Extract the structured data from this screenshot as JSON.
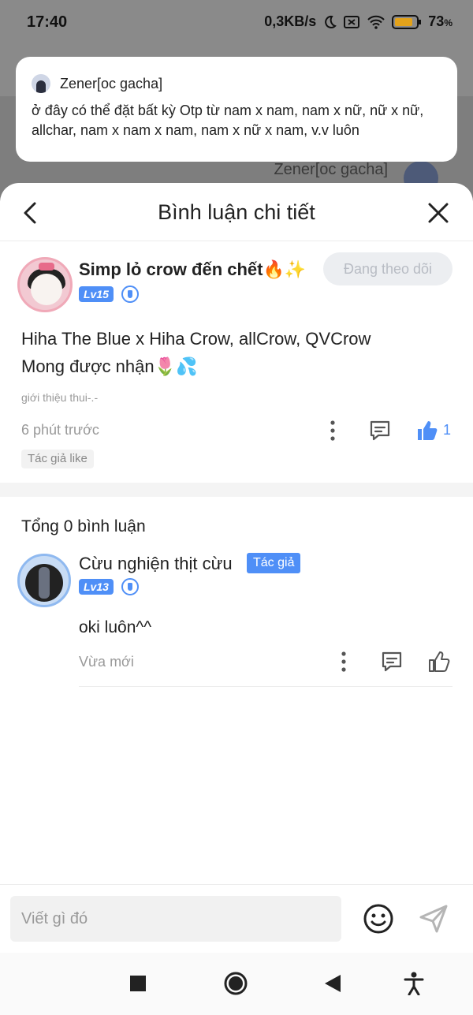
{
  "status_bar": {
    "time": "17:40",
    "network_speed": "0,3KB/s",
    "battery": "73",
    "battery_unit": "%"
  },
  "background": {
    "author_name": "Zener[oc gacha]"
  },
  "notification": {
    "author": "Zener[oc gacha]",
    "message": "ở đây có thể đặt bất kỳ Otp từ nam  x nam, nam x nữ, nữ x nữ, allchar, nam x nam x nam, nam x nữ x nam, v.v luôn"
  },
  "sheet": {
    "title": "Bình luận chi tiết"
  },
  "post": {
    "username": "Simp lỏ crow đến chết🔥✨",
    "level": "Lv15",
    "follow_label": "Đang theo dõi",
    "text_line1": "Hiha The Blue x Hiha Crow, allCrow, QVCrow",
    "text_line2": "Mong được nhận🌷💦",
    "subtext": "giới thiệu thui-.-",
    "time": "6 phút trước",
    "like_count": "1",
    "author_like": "Tác giả like"
  },
  "comments": {
    "total_label": "Tổng 0 bình luận",
    "items": [
      {
        "username": "Cừu nghiện thịt cừu",
        "tag": "Tác giả",
        "level": "Lv13",
        "text": "oki luôn^^",
        "time": "Vừa mới"
      }
    ]
  },
  "input": {
    "placeholder": "Viết gì đó"
  },
  "colors": {
    "accent": "#4f8ff7",
    "muted": "#999999"
  }
}
